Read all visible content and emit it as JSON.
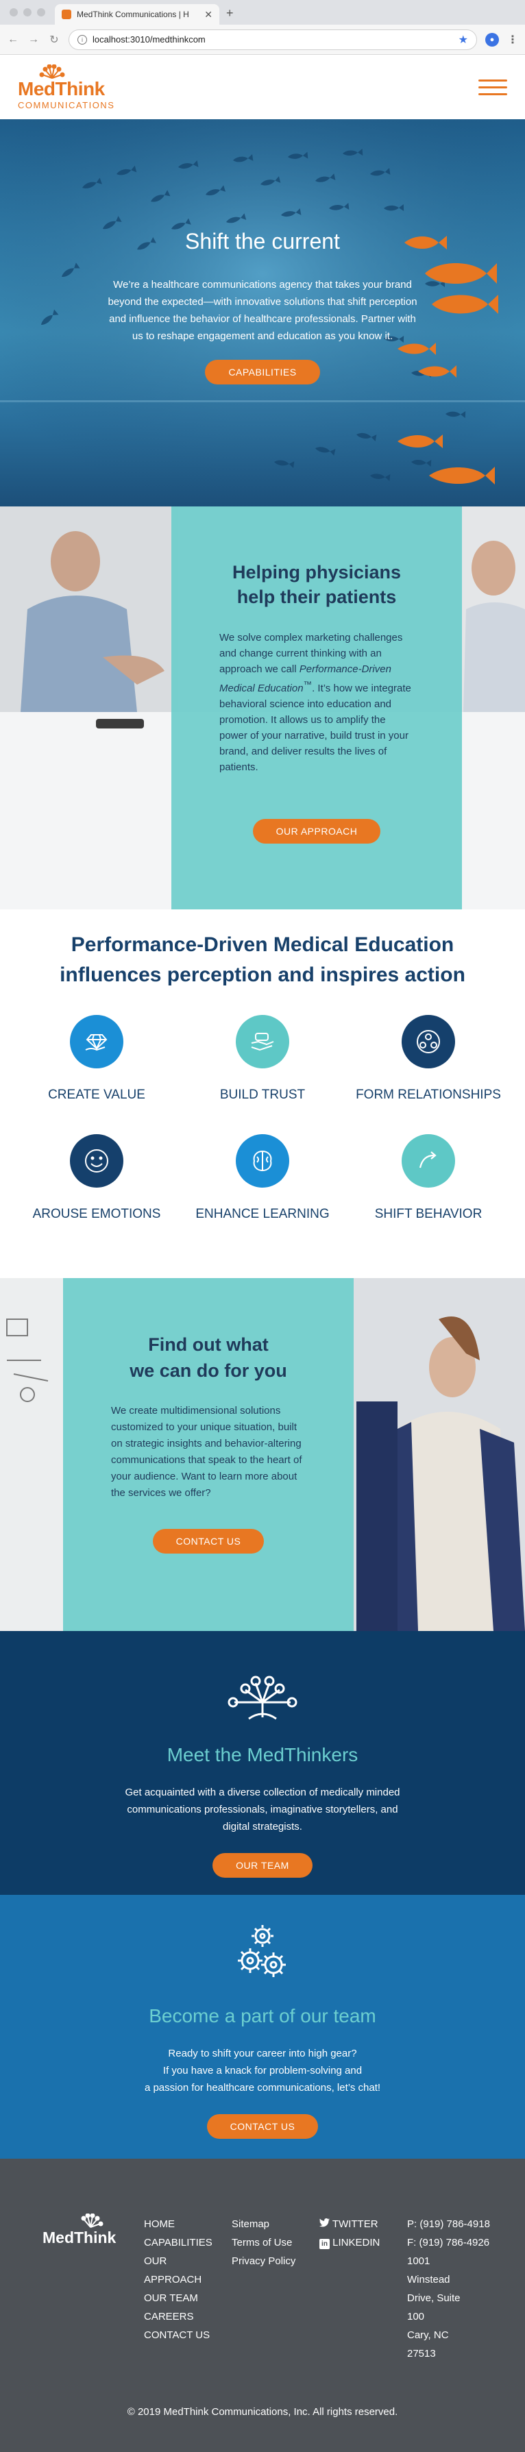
{
  "browser": {
    "tab_title": "MedThink Communications | H",
    "url": "localhost:3010/medthinkcom"
  },
  "header": {
    "logo_word": "MedThink",
    "logo_sub": "COMMUNICATIONS"
  },
  "hero": {
    "title": "Shift the current",
    "body": "We’re a healthcare communications agency that takes your brand beyond the expected—with innovative solutions that shift perception and influence the behavior of healthcare professionals. Partner with us to reshape engagement and education as you know it.",
    "button": "CAPABILITIES"
  },
  "physicians": {
    "title_line1": "Helping physicians",
    "title_line2": "help their patients",
    "body_before": "We solve complex marketing challenges and change current thinking with an approach we call ",
    "body_italic": "Performance-Driven Medical Education",
    "body_tm": "™",
    "body_after": ". It’s how we integrate behavioral science into education and promotion. It allows us to amplify the power of your narrative, build trust in your brand, and deliver results the lives of patients.",
    "button": "OUR APPROACH"
  },
  "pdme": {
    "title_line1": "Performance-Driven Medical Education",
    "title_line2": "influences perception and inspires action",
    "items": [
      {
        "label": "CREATE VALUE",
        "icon": "diamond-hand-icon",
        "color": "#1b8fd6"
      },
      {
        "label": "BUILD TRUST",
        "icon": "handshake-icon",
        "color": "#5ec8c6"
      },
      {
        "label": "FORM RELATIONSHIPS",
        "icon": "people-network-icon",
        "color": "#15406c"
      },
      {
        "label": "AROUSE EMOTIONS",
        "icon": "smiley-icon",
        "color": "#15406c"
      },
      {
        "label": "ENHANCE LEARNING",
        "icon": "brain-icon",
        "color": "#1b8fd6"
      },
      {
        "label": "SHIFT BEHAVIOR",
        "icon": "curved-arrow-icon",
        "color": "#5ec8c6"
      }
    ]
  },
  "findout": {
    "title_line1": "Find out what",
    "title_line2": "we can do for you",
    "body": "We create multidimensional solutions customized to your unique situation, built on strategic insights and behavior-altering communications that speak to the heart of your audience. Want to learn more about the services we offer?",
    "button": "CONTACT US"
  },
  "meet": {
    "title": "Meet the MedThinkers",
    "body": "Get acquainted with a diverse collection of medically minded communications professionals, imaginative storytellers, and digital strategists.",
    "button": "OUR TEAM"
  },
  "team": {
    "title": "Become a part of our team",
    "line1": "Ready to shift your career into high gear?",
    "line2": "If you have a knack for problem-solving and",
    "line3": "a passion for healthcare communications, let’s chat!",
    "button": "CONTACT US"
  },
  "footer": {
    "logo_word": "MedThink",
    "nav": [
      "HOME",
      "CAPABILITIES",
      "OUR APPROACH",
      "OUR TEAM",
      "CAREERS",
      "CONTACT US"
    ],
    "links": [
      "Sitemap",
      "Terms of Use",
      "Privacy Policy"
    ],
    "social": [
      "TWITTER",
      "LINKEDIN"
    ],
    "phone": "P: (919) 786-4918",
    "fax": "F: (919) 786-4926",
    "address": "1001 Winstead Drive, Suite 100",
    "city": "Cary, NC",
    "zip": "27513",
    "copyright": "© 2019 MedThink Communications, Inc. All rights reserved."
  },
  "colors": {
    "brand_orange": "#e87722",
    "navy": "#17406a",
    "teal": "#6ecdcb",
    "footer": "#4d5156"
  }
}
